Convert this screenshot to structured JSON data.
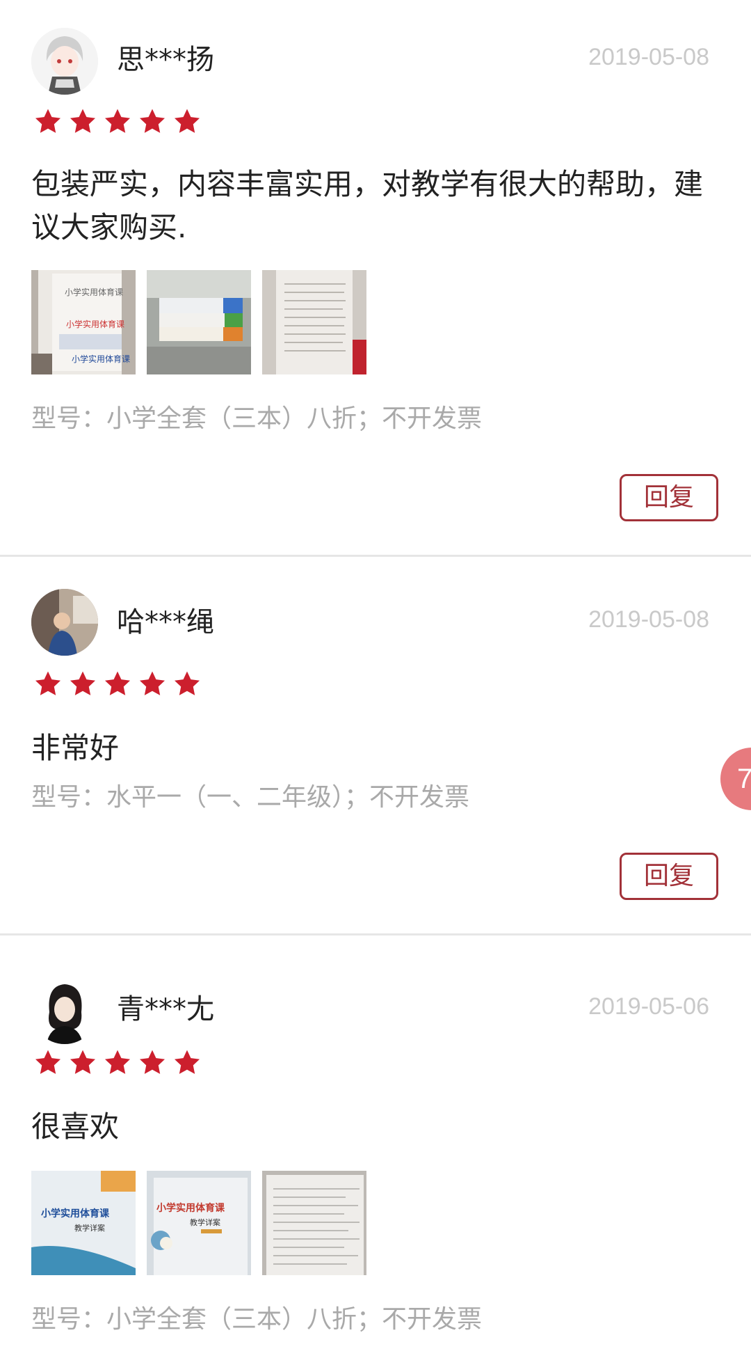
{
  "colors": {
    "star": "#cc1f2d",
    "accent": "#a23138",
    "date": "#c9c9c9",
    "variant": "#a9a9a9",
    "badge": "#e77a7e"
  },
  "reviews": [
    {
      "username": "思***扬",
      "date": "2019-05-08",
      "rating": 5,
      "text": "包装严实，内容丰富实用，对教学有很大的帮助，建议大家购买.",
      "images": [
        {
          "label": "小学实用体育课",
          "icon": "book-photo"
        },
        {
          "label": "",
          "icon": "book-stack-photo"
        },
        {
          "label": "",
          "icon": "open-book-photo"
        }
      ],
      "variant": "型号：小学全套（三本）八折；不开发票",
      "reply_label": "回复"
    },
    {
      "username": "哈***绳",
      "date": "2019-05-08",
      "rating": 5,
      "text": "非常好",
      "images": [],
      "variant": "型号：水平一（一、二年级）；不开发票",
      "reply_label": "回复"
    },
    {
      "username": "青***尢",
      "date": "2019-05-06",
      "rating": 5,
      "text": "很喜欢",
      "images": [
        {
          "label": "小学实用体育课",
          "sub": "教学详案",
          "icon": "book-cover-photo"
        },
        {
          "label": "小学实用体育课",
          "sub": "教学详案",
          "icon": "book-cover-photo"
        },
        {
          "label": "",
          "icon": "book-page-photo"
        }
      ],
      "variant": "型号：小学全套（三本）八折；不开发票"
    }
  ],
  "float_badge": "7"
}
